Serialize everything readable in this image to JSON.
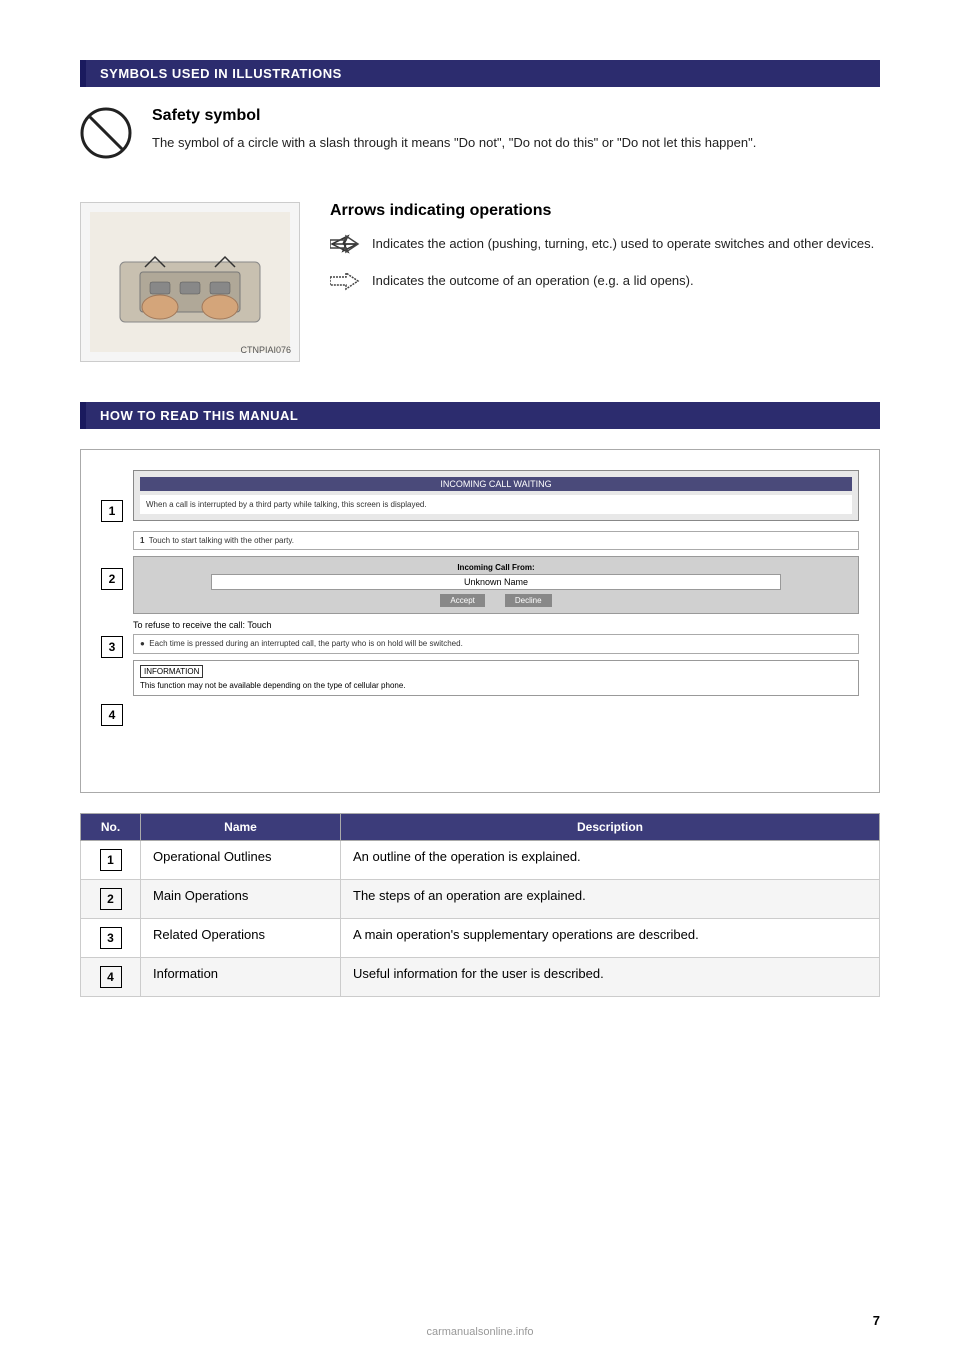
{
  "page": {
    "number": "7",
    "background": "#ffffff"
  },
  "sections": {
    "symbols_header": "SYMBOLS USED IN ILLUSTRATIONS",
    "how_to_header": "HOW TO READ THIS MANUAL"
  },
  "safety_symbol": {
    "title": "Safety symbol",
    "description": "The symbol of a circle with a slash through it means \"Do not\", \"Do not do this\" or \"Do not let this happen\"."
  },
  "arrows": {
    "title": "Arrows indicating operations",
    "image_caption": "CTNPIAI076",
    "items": [
      {
        "text": "Indicates the action (pushing, turning, etc.) used to operate switches and other devices."
      },
      {
        "text": "Indicates the outcome of an operation (e.g. a lid opens)."
      }
    ]
  },
  "diagram": {
    "screen_header": "INCOMING CALL WAITING",
    "screen_text1": "When a call is interrupted by a third party while talking, this screen is displayed.",
    "step1_text": "Touch    to start talking with the other party.",
    "call_from_label": "Incoming Call From:",
    "call_name": "Unknown Name",
    "refuse_text": "To refuse to receive the call: Touch",
    "step3_text": "Each time    is pressed during an interrupted call, the party who is on hold will be switched.",
    "info_label": "INFORMATION",
    "info_text": "This function may not be available depending on the type of cellular phone."
  },
  "table": {
    "columns": [
      "No.",
      "Name",
      "Description"
    ],
    "rows": [
      {
        "num": "1",
        "name": "Operational Outlines",
        "description": "An outline of the operation is explained."
      },
      {
        "num": "2",
        "name": "Main Operations",
        "description": "The steps of an operation are explained."
      },
      {
        "num": "3",
        "name": "Related Operations",
        "description": "A main operation's supplementary operations are described."
      },
      {
        "num": "4",
        "name": "Information",
        "description": "Useful information for the user is described."
      }
    ]
  },
  "watermark": "carmanualsonline.info"
}
